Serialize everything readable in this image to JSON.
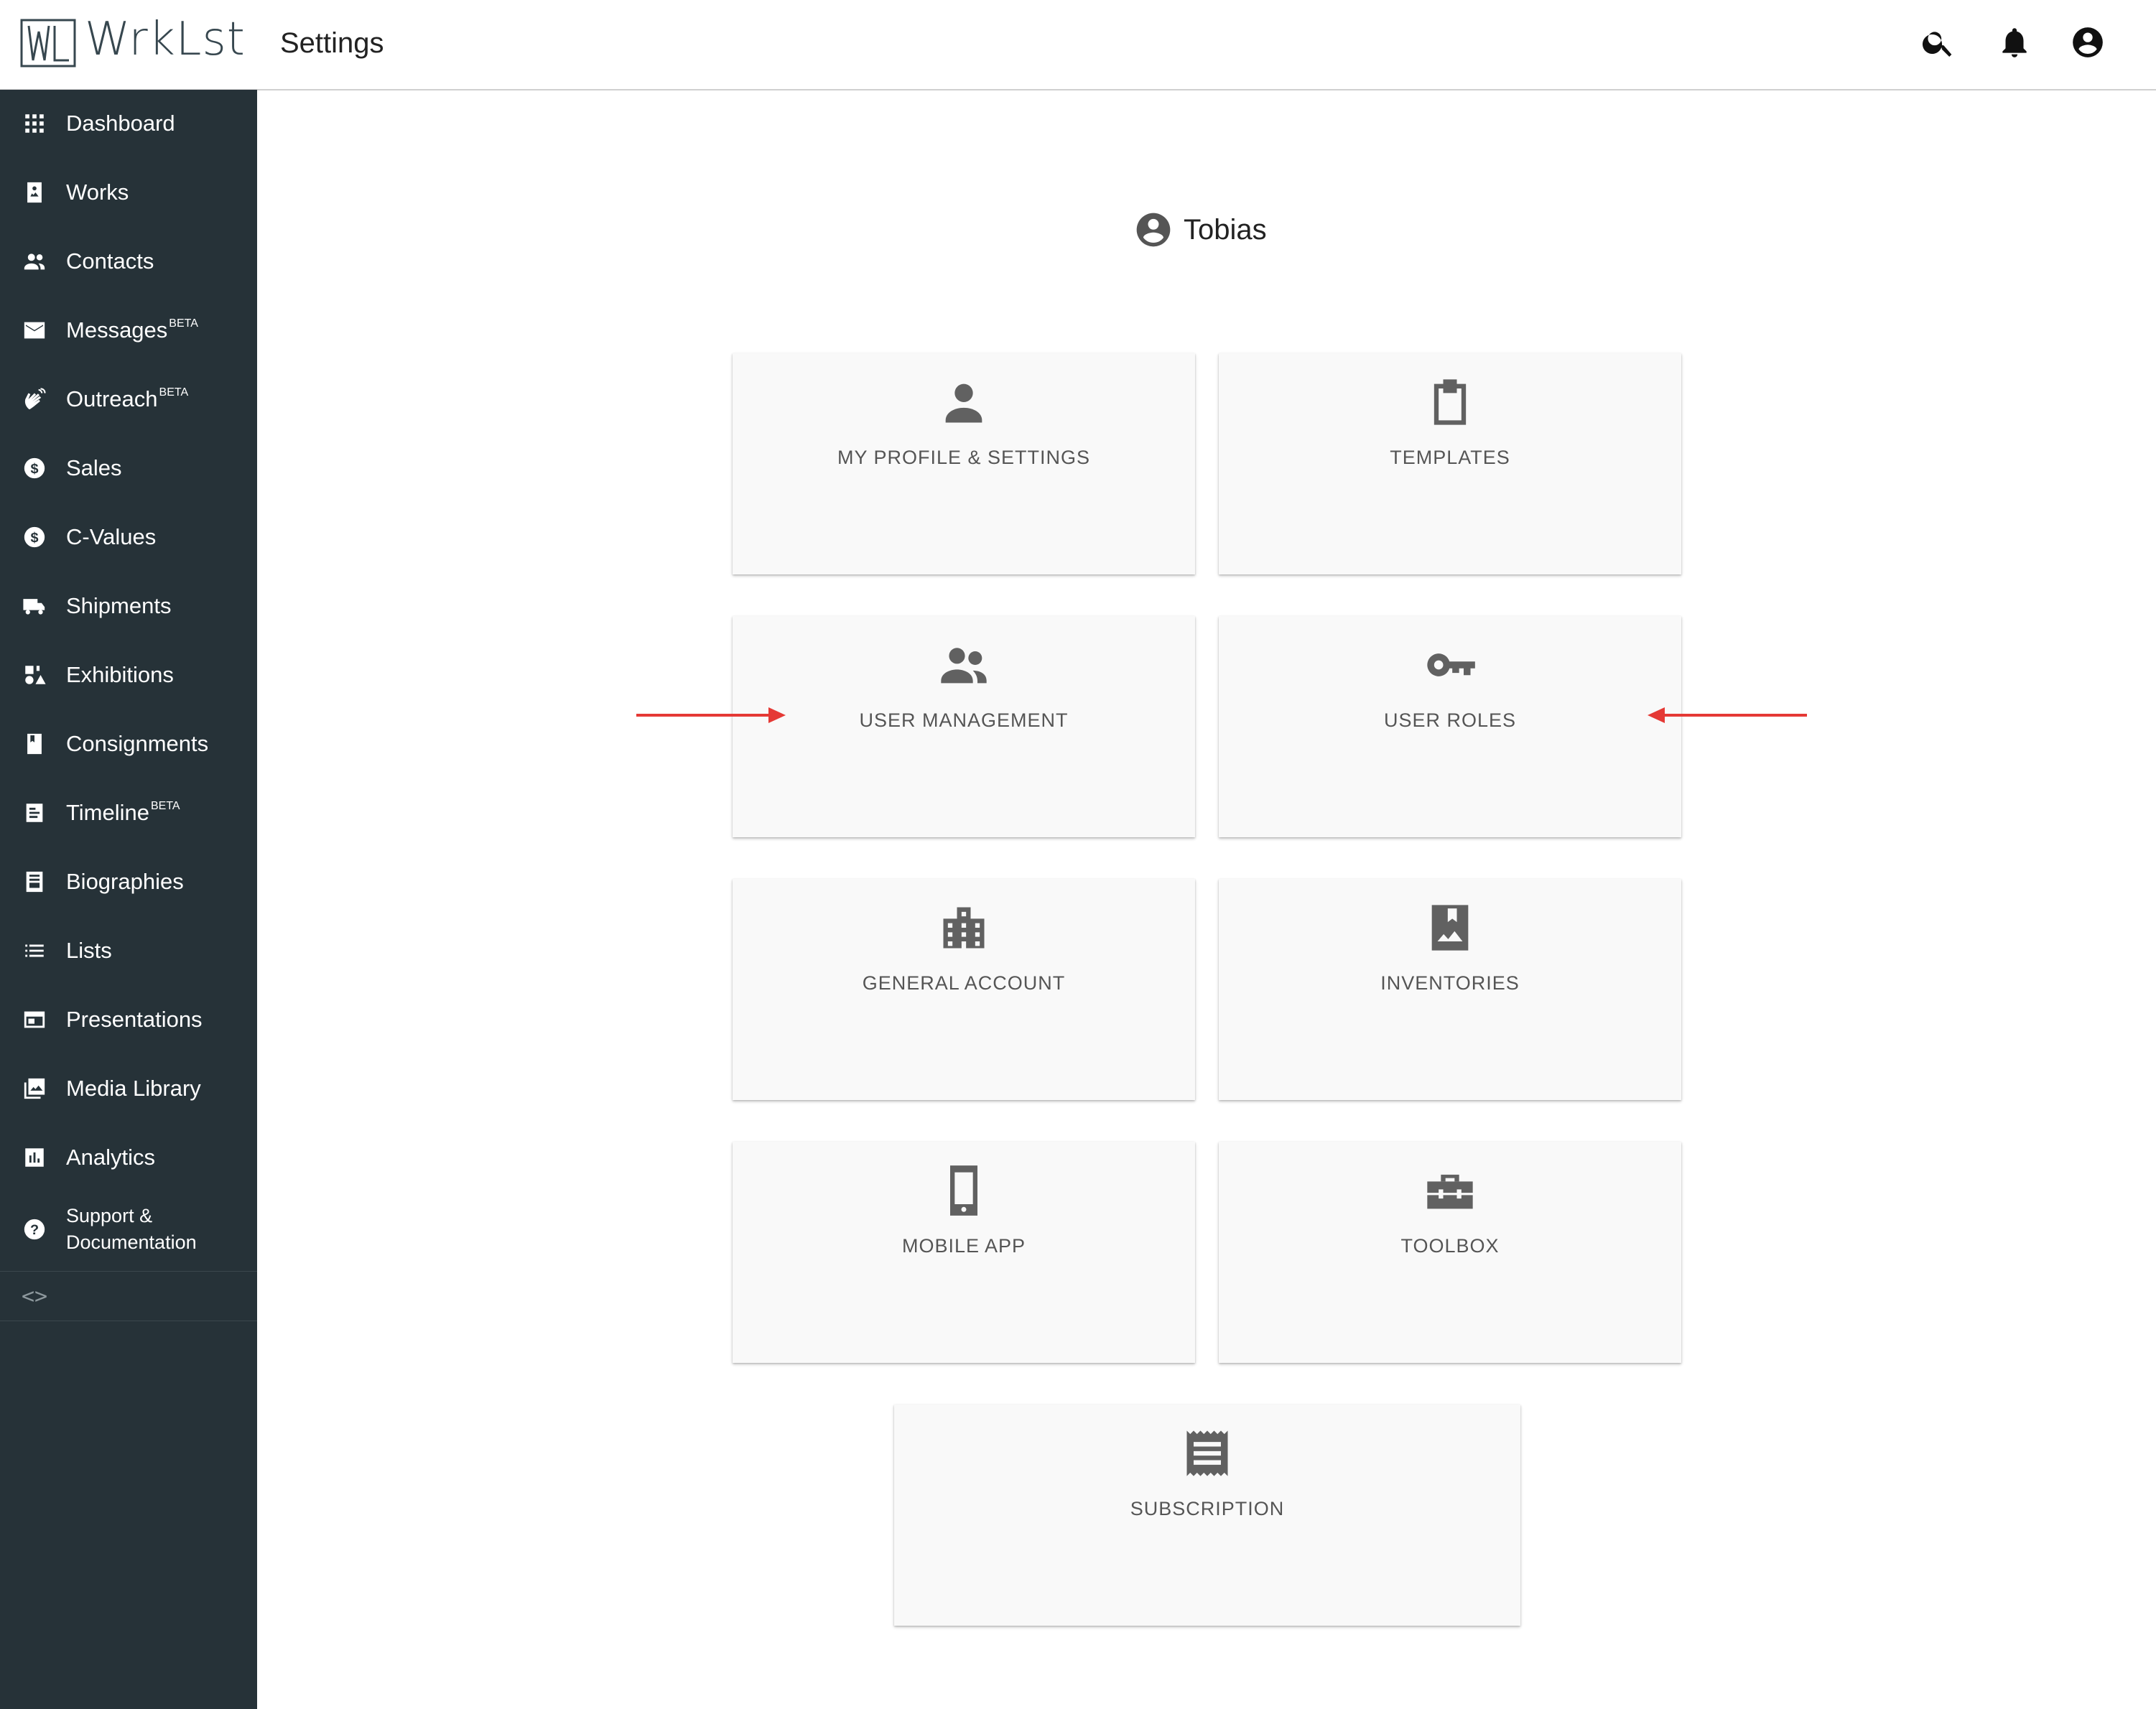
{
  "app": {
    "logo_text": "WrkLst"
  },
  "header": {
    "title": "Settings"
  },
  "sidebar": {
    "items": [
      {
        "label": "Dashboard",
        "icon": "dashboard-icon"
      },
      {
        "label": "Works",
        "icon": "works-icon"
      },
      {
        "label": "Contacts",
        "icon": "contacts-icon"
      },
      {
        "label": "Messages",
        "badge": "BETA",
        "icon": "mail-icon"
      },
      {
        "label": "Outreach",
        "badge": "BETA",
        "icon": "outreach-icon"
      },
      {
        "label": "Sales",
        "icon": "dollar-icon"
      },
      {
        "label": "C-Values",
        "icon": "dollar-icon"
      },
      {
        "label": "Shipments",
        "icon": "truck-icon"
      },
      {
        "label": "Exhibitions",
        "icon": "shapes-icon"
      },
      {
        "label": "Consignments",
        "icon": "book-icon"
      },
      {
        "label": "Timeline",
        "badge": "BETA",
        "icon": "timeline-icon"
      },
      {
        "label": "Biographies",
        "icon": "biography-icon"
      },
      {
        "label": "Lists",
        "icon": "list-icon"
      },
      {
        "label": "Presentations",
        "icon": "presentation-icon"
      },
      {
        "label": "Media Library",
        "icon": "image-library-icon"
      },
      {
        "label": "Analytics",
        "icon": "chart-icon"
      },
      {
        "label_line1": "Support &",
        "label_line2": "Documentation",
        "icon": "help-icon"
      }
    ],
    "collapse_symbol": "<>"
  },
  "main": {
    "user_name": "Tobias",
    "cards": [
      {
        "label": "MY PROFILE & SETTINGS",
        "icon": "person-icon"
      },
      {
        "label": "TEMPLATES",
        "icon": "clipboard-icon"
      },
      {
        "label": "USER MANAGEMENT",
        "icon": "people-icon"
      },
      {
        "label": "USER ROLES",
        "icon": "key-icon"
      },
      {
        "label": "GENERAL ACCOUNT",
        "icon": "building-icon"
      },
      {
        "label": "INVENTORIES",
        "icon": "bookmark-image-icon"
      },
      {
        "label": "MOBILE APP",
        "icon": "smartphone-icon"
      },
      {
        "label": "TOOLBOX",
        "icon": "toolbox-icon"
      },
      {
        "label": "SUBSCRIPTION",
        "icon": "receipt-icon"
      }
    ]
  },
  "colors": {
    "sidebar_bg": "#263238",
    "card_bg": "#f9f9f9",
    "icon_gray": "#616161",
    "annotation_arrow": "#e53935"
  }
}
